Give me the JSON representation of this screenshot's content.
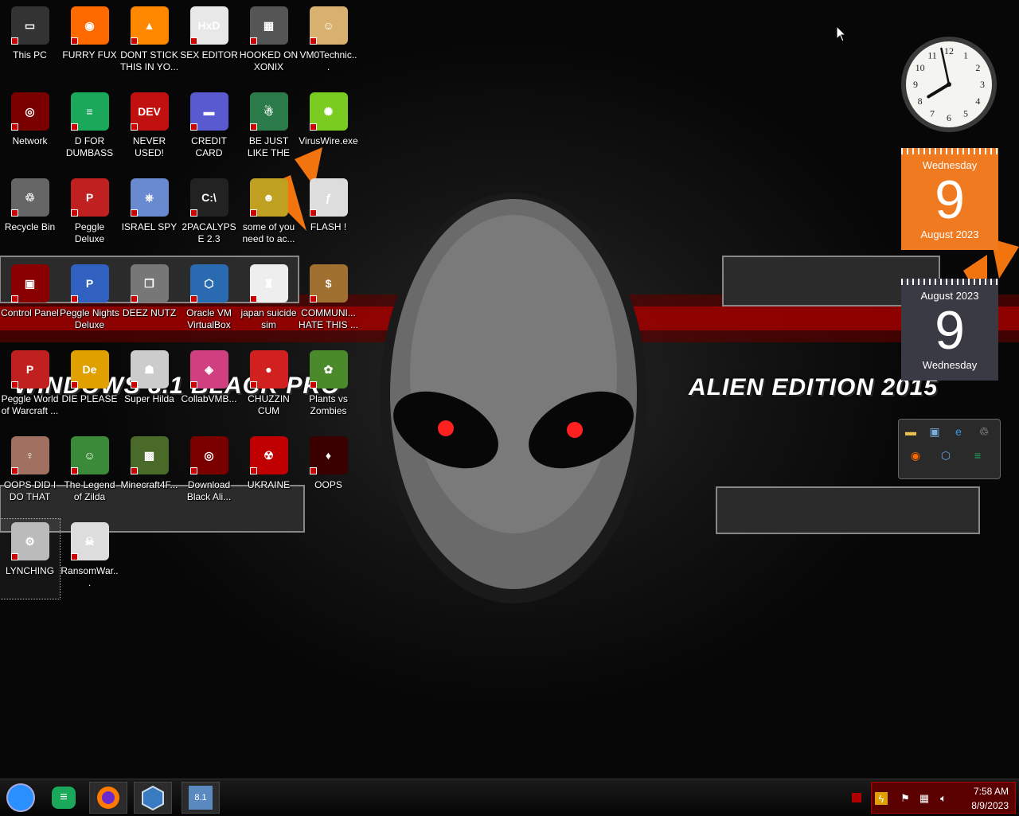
{
  "desktop": {
    "icons": [
      {
        "label": "This PC",
        "glyph": "▭",
        "color": "#333"
      },
      {
        "label": "FURRY FUX",
        "glyph": "◉",
        "color": "#ff6a00"
      },
      {
        "label": "DONT STICK THIS IN YO...",
        "glyph": "▲",
        "color": "#ff8800"
      },
      {
        "label": "SEX EDITOR",
        "glyph": "HxD",
        "color": "#e8e8e8"
      },
      {
        "label": "HOOKED ON XONIX",
        "glyph": "▦",
        "color": "#555"
      },
      {
        "label": "VM0Technic...",
        "glyph": "☺",
        "color": "#d8b070"
      },
      {
        "label": "Network",
        "glyph": "◎",
        "color": "#7a0000"
      },
      {
        "label": "D FOR DUMBASS",
        "glyph": "≡",
        "color": "#1aa85a"
      },
      {
        "label": "NEVER USED!",
        "glyph": "DEV",
        "color": "#c01010"
      },
      {
        "label": "CREDIT CARD CHECKER",
        "glyph": "▬",
        "color": "#5a5ad0"
      },
      {
        "label": "BE JUST LIKE THE DUDE!",
        "glyph": "☃",
        "color": "#2a7a4a"
      },
      {
        "label": "VirusWire.exe",
        "glyph": "✺",
        "color": "#7acc20"
      },
      {
        "label": "Recycle Bin",
        "glyph": "♲",
        "color": "#666"
      },
      {
        "label": "Peggle Deluxe",
        "glyph": "P",
        "color": "#c02020"
      },
      {
        "label": "ISRAEL SPY",
        "glyph": "⎈",
        "color": "#6a8ad0"
      },
      {
        "label": "2PACALYPSE 2.3",
        "glyph": "C:\\",
        "color": "#222"
      },
      {
        "label": "some of you need to ac...",
        "glyph": "☻",
        "color": "#c0a020"
      },
      {
        "label": "FLASH !",
        "glyph": "ƒ",
        "color": "#ddd"
      },
      {
        "label": "Control Panel",
        "glyph": "▣",
        "color": "#8a0000"
      },
      {
        "label": "Peggle Nights Deluxe",
        "glyph": "P",
        "color": "#3060c0"
      },
      {
        "label": "DEEZ NUTZ",
        "glyph": "❐",
        "color": "#777"
      },
      {
        "label": "Oracle VM VirtualBox",
        "glyph": "⬡",
        "color": "#2a6ab0"
      },
      {
        "label": "japan suicide sim",
        "glyph": "♜",
        "color": "#eee"
      },
      {
        "label": "COMMUNI... HATE THIS ...",
        "glyph": "$",
        "color": "#a07030"
      },
      {
        "label": "Peggle World of Warcraft ...",
        "glyph": "P",
        "color": "#c02020"
      },
      {
        "label": "DIE PLEASE",
        "glyph": "De",
        "color": "#e0a000"
      },
      {
        "label": "Super Hilda",
        "glyph": "☗",
        "color": "#ccc"
      },
      {
        "label": "CollabVMB...",
        "glyph": "◈",
        "color": "#d04080"
      },
      {
        "label": "CHUZZIN CUM",
        "glyph": "●",
        "color": "#d02020"
      },
      {
        "label": "Plants vs Zombies",
        "glyph": "✿",
        "color": "#4a8a2a"
      },
      {
        "label": "OOPS DID I DO THAT",
        "glyph": "♀",
        "color": "#a07060"
      },
      {
        "label": "The Legend of Zilda",
        "glyph": "☺",
        "color": "#3a8a3a"
      },
      {
        "label": "Minecraft4F...",
        "glyph": "▩",
        "color": "#4a6a2a"
      },
      {
        "label": "Download Black Ali...",
        "glyph": "◎",
        "color": "#7a0000"
      },
      {
        "label": "UKRAINE",
        "glyph": "☢",
        "color": "#c00000"
      },
      {
        "label": "OOPS",
        "glyph": "♦",
        "color": "#3a0000"
      },
      {
        "label": "LYNCHING",
        "glyph": "⚙",
        "color": "#bbb"
      },
      {
        "label": "RansomWar...",
        "glyph": "☠",
        "color": "#ddd"
      }
    ],
    "banner_left": "WINDOWS 8.1 BLACK PRO",
    "banner_right": "ALIEN EDITION 2015"
  },
  "gadgets": {
    "calendar1": {
      "weekday": "Wednesday",
      "day": "9",
      "month": "August 2023"
    },
    "calendar2": {
      "month": "August 2023",
      "day": "9",
      "weekday": "Wednesday"
    },
    "clock": {
      "hour": 7,
      "minute": 58
    }
  },
  "taskbar": {
    "pinned": [
      {
        "name": "start-orb",
        "glyph": "●"
      },
      {
        "name": "app-green",
        "glyph": "≡"
      },
      {
        "name": "firefox",
        "glyph": "◉"
      },
      {
        "name": "virtualbox",
        "glyph": "⬡"
      },
      {
        "name": "windows-81",
        "glyph": "8.1"
      }
    ],
    "tray": {
      "time": "7:58 AM",
      "date": "8/9/2023"
    }
  },
  "colors": {
    "accent": "#b00000",
    "calendar_orange": "#f07a20"
  }
}
